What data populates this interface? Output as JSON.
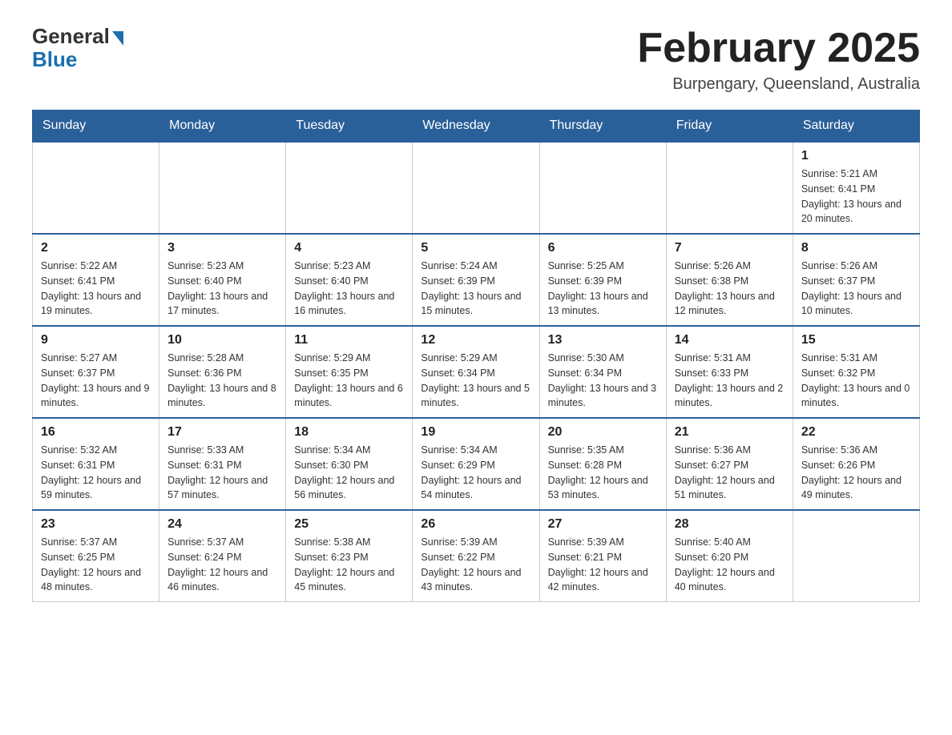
{
  "logo": {
    "general": "General",
    "blue": "Blue"
  },
  "header": {
    "title": "February 2025",
    "location": "Burpengary, Queensland, Australia"
  },
  "weekdays": [
    "Sunday",
    "Monday",
    "Tuesday",
    "Wednesday",
    "Thursday",
    "Friday",
    "Saturday"
  ],
  "weeks": [
    [
      {
        "day": "",
        "info": ""
      },
      {
        "day": "",
        "info": ""
      },
      {
        "day": "",
        "info": ""
      },
      {
        "day": "",
        "info": ""
      },
      {
        "day": "",
        "info": ""
      },
      {
        "day": "",
        "info": ""
      },
      {
        "day": "1",
        "info": "Sunrise: 5:21 AM\nSunset: 6:41 PM\nDaylight: 13 hours and 20 minutes."
      }
    ],
    [
      {
        "day": "2",
        "info": "Sunrise: 5:22 AM\nSunset: 6:41 PM\nDaylight: 13 hours and 19 minutes."
      },
      {
        "day": "3",
        "info": "Sunrise: 5:23 AM\nSunset: 6:40 PM\nDaylight: 13 hours and 17 minutes."
      },
      {
        "day": "4",
        "info": "Sunrise: 5:23 AM\nSunset: 6:40 PM\nDaylight: 13 hours and 16 minutes."
      },
      {
        "day": "5",
        "info": "Sunrise: 5:24 AM\nSunset: 6:39 PM\nDaylight: 13 hours and 15 minutes."
      },
      {
        "day": "6",
        "info": "Sunrise: 5:25 AM\nSunset: 6:39 PM\nDaylight: 13 hours and 13 minutes."
      },
      {
        "day": "7",
        "info": "Sunrise: 5:26 AM\nSunset: 6:38 PM\nDaylight: 13 hours and 12 minutes."
      },
      {
        "day": "8",
        "info": "Sunrise: 5:26 AM\nSunset: 6:37 PM\nDaylight: 13 hours and 10 minutes."
      }
    ],
    [
      {
        "day": "9",
        "info": "Sunrise: 5:27 AM\nSunset: 6:37 PM\nDaylight: 13 hours and 9 minutes."
      },
      {
        "day": "10",
        "info": "Sunrise: 5:28 AM\nSunset: 6:36 PM\nDaylight: 13 hours and 8 minutes."
      },
      {
        "day": "11",
        "info": "Sunrise: 5:29 AM\nSunset: 6:35 PM\nDaylight: 13 hours and 6 minutes."
      },
      {
        "day": "12",
        "info": "Sunrise: 5:29 AM\nSunset: 6:34 PM\nDaylight: 13 hours and 5 minutes."
      },
      {
        "day": "13",
        "info": "Sunrise: 5:30 AM\nSunset: 6:34 PM\nDaylight: 13 hours and 3 minutes."
      },
      {
        "day": "14",
        "info": "Sunrise: 5:31 AM\nSunset: 6:33 PM\nDaylight: 13 hours and 2 minutes."
      },
      {
        "day": "15",
        "info": "Sunrise: 5:31 AM\nSunset: 6:32 PM\nDaylight: 13 hours and 0 minutes."
      }
    ],
    [
      {
        "day": "16",
        "info": "Sunrise: 5:32 AM\nSunset: 6:31 PM\nDaylight: 12 hours and 59 minutes."
      },
      {
        "day": "17",
        "info": "Sunrise: 5:33 AM\nSunset: 6:31 PM\nDaylight: 12 hours and 57 minutes."
      },
      {
        "day": "18",
        "info": "Sunrise: 5:34 AM\nSunset: 6:30 PM\nDaylight: 12 hours and 56 minutes."
      },
      {
        "day": "19",
        "info": "Sunrise: 5:34 AM\nSunset: 6:29 PM\nDaylight: 12 hours and 54 minutes."
      },
      {
        "day": "20",
        "info": "Sunrise: 5:35 AM\nSunset: 6:28 PM\nDaylight: 12 hours and 53 minutes."
      },
      {
        "day": "21",
        "info": "Sunrise: 5:36 AM\nSunset: 6:27 PM\nDaylight: 12 hours and 51 minutes."
      },
      {
        "day": "22",
        "info": "Sunrise: 5:36 AM\nSunset: 6:26 PM\nDaylight: 12 hours and 49 minutes."
      }
    ],
    [
      {
        "day": "23",
        "info": "Sunrise: 5:37 AM\nSunset: 6:25 PM\nDaylight: 12 hours and 48 minutes."
      },
      {
        "day": "24",
        "info": "Sunrise: 5:37 AM\nSunset: 6:24 PM\nDaylight: 12 hours and 46 minutes."
      },
      {
        "day": "25",
        "info": "Sunrise: 5:38 AM\nSunset: 6:23 PM\nDaylight: 12 hours and 45 minutes."
      },
      {
        "day": "26",
        "info": "Sunrise: 5:39 AM\nSunset: 6:22 PM\nDaylight: 12 hours and 43 minutes."
      },
      {
        "day": "27",
        "info": "Sunrise: 5:39 AM\nSunset: 6:21 PM\nDaylight: 12 hours and 42 minutes."
      },
      {
        "day": "28",
        "info": "Sunrise: 5:40 AM\nSunset: 6:20 PM\nDaylight: 12 hours and 40 minutes."
      },
      {
        "day": "",
        "info": ""
      }
    ]
  ]
}
